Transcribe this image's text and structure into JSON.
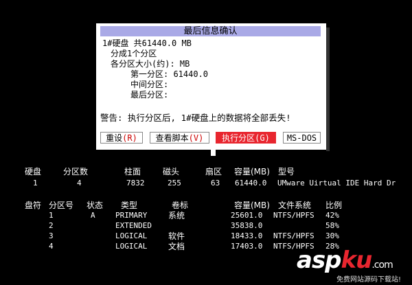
{
  "dialog": {
    "title": "最后信息确认",
    "lines": [
      "1#硬盘 共61440.0 MB",
      "分成1个分区",
      "各分区大小(约): MB",
      "第一分区: 61440.0",
      "中间分区:",
      "最后分区:"
    ],
    "warning": "警告: 执行分区后, 1#硬盘上的数据将全部丢失!",
    "buttons": [
      {
        "label": "重设",
        "hotkey": "(R)",
        "active": false
      },
      {
        "label": "查看脚本",
        "hotkey": "(V)",
        "active": false
      },
      {
        "label": "执行分区",
        "hotkey": "(G)",
        "active": true
      },
      {
        "label": "MS-DOS",
        "hotkey": "",
        "active": false
      }
    ]
  },
  "disk_table": {
    "headers": [
      "硬盘",
      "分区数",
      "柱面",
      "磁头",
      "扇区",
      "容量(MB)",
      "型号"
    ],
    "rows": [
      [
        "1",
        "4",
        "7832",
        "255",
        "63",
        "61440.0",
        "UMware Uirtual IDE Hard Dr"
      ]
    ]
  },
  "partition_table": {
    "headers": [
      "盘符",
      "分区号",
      "状态",
      "类型",
      "卷标",
      "容量(MB)",
      "文件系统",
      "比例"
    ],
    "rows": [
      [
        "",
        "1",
        "A",
        "PRIMARY",
        "系统",
        "25601.0",
        "NTFS/HPFS",
        "42%"
      ],
      [
        "",
        "2",
        "",
        "EXTENDED",
        "",
        "35838.0",
        "",
        "58%"
      ],
      [
        "",
        "3",
        "",
        "LOGICAL",
        "软件",
        "18433.0",
        "NTFS/HPFS",
        "30%"
      ],
      [
        "",
        "4",
        "",
        "LOGICAL",
        "文档",
        "17403.0",
        "NTFS/HPFS",
        "28%"
      ]
    ]
  },
  "watermark": {
    "brand_a": "asp",
    "brand_b": "ku",
    "brand_c": ".com",
    "sub": "免费网站源码下载站!",
    "colors": {
      "a": "#ffffff",
      "b": "#e8262f",
      "c": "#ffffff"
    }
  }
}
